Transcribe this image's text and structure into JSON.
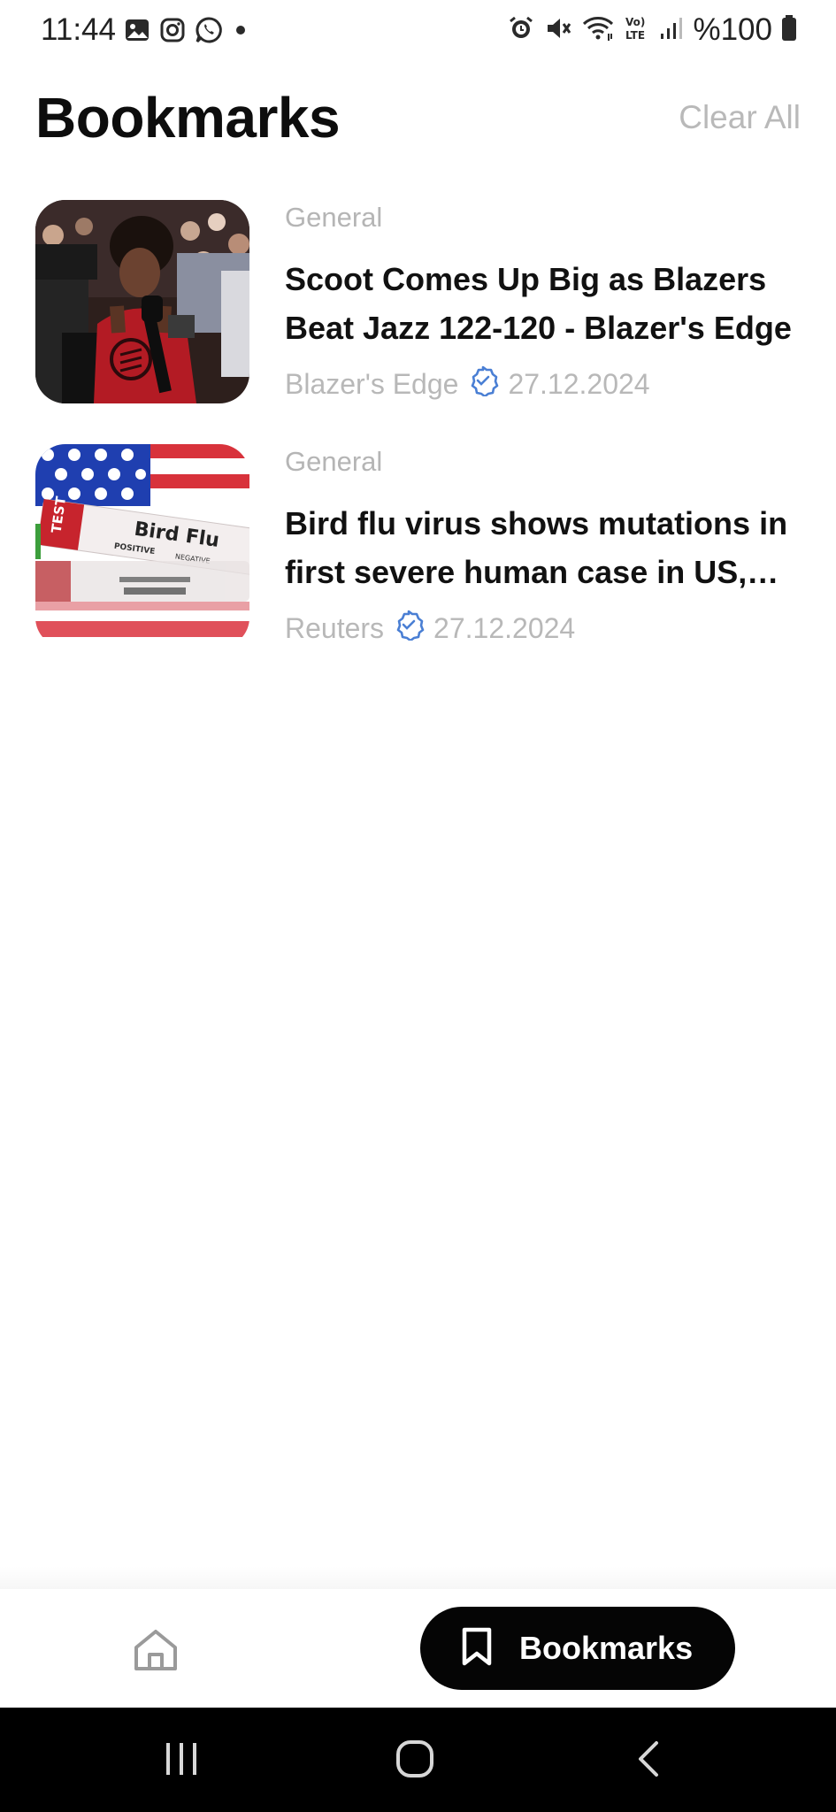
{
  "status_bar": {
    "time": "11:44",
    "battery": "%100",
    "left_icons": [
      "gallery-icon",
      "instagram-icon",
      "whatsapp-icon",
      "dot-icon"
    ],
    "right_icons": [
      "alarm-icon",
      "mute-icon",
      "wifi-icon",
      "volte-icon",
      "signal-icon",
      "battery-icon"
    ],
    "volte_text": "Vo) LTE"
  },
  "header": {
    "title": "Bookmarks",
    "clear_all": "Clear All"
  },
  "articles": [
    {
      "category": "General",
      "headline": "Scoot Comes Up Big as Blazers Beat Jazz 122-120 - Blazer's Edge",
      "source": "Blazer's Edge",
      "date": "27.12.2024",
      "thumbnail": "basketball-interview-photo"
    },
    {
      "category": "General",
      "headline": "Bird flu virus shows mutations in first severe human case in US, CDC says",
      "source": "Reuters",
      "date": "27.12.2024",
      "thumbnail": "bird-flu-test-tubes-photo",
      "thumb_text": {
        "main": "Bird Flu",
        "test": "TEST",
        "positive": "POSITIVE",
        "negative": "NEGATIVE"
      }
    }
  ],
  "bottom_nav": {
    "home_icon": "home-icon",
    "bookmarks_label": "Bookmarks",
    "bookmarks_icon": "bookmark-icon"
  },
  "system_nav": [
    "recents-icon",
    "home-circle-icon",
    "back-icon"
  ],
  "colors": {
    "accent_pill": "#050505",
    "muted_text": "#b8b8b8",
    "verified_blue": "#4a7fd4"
  }
}
